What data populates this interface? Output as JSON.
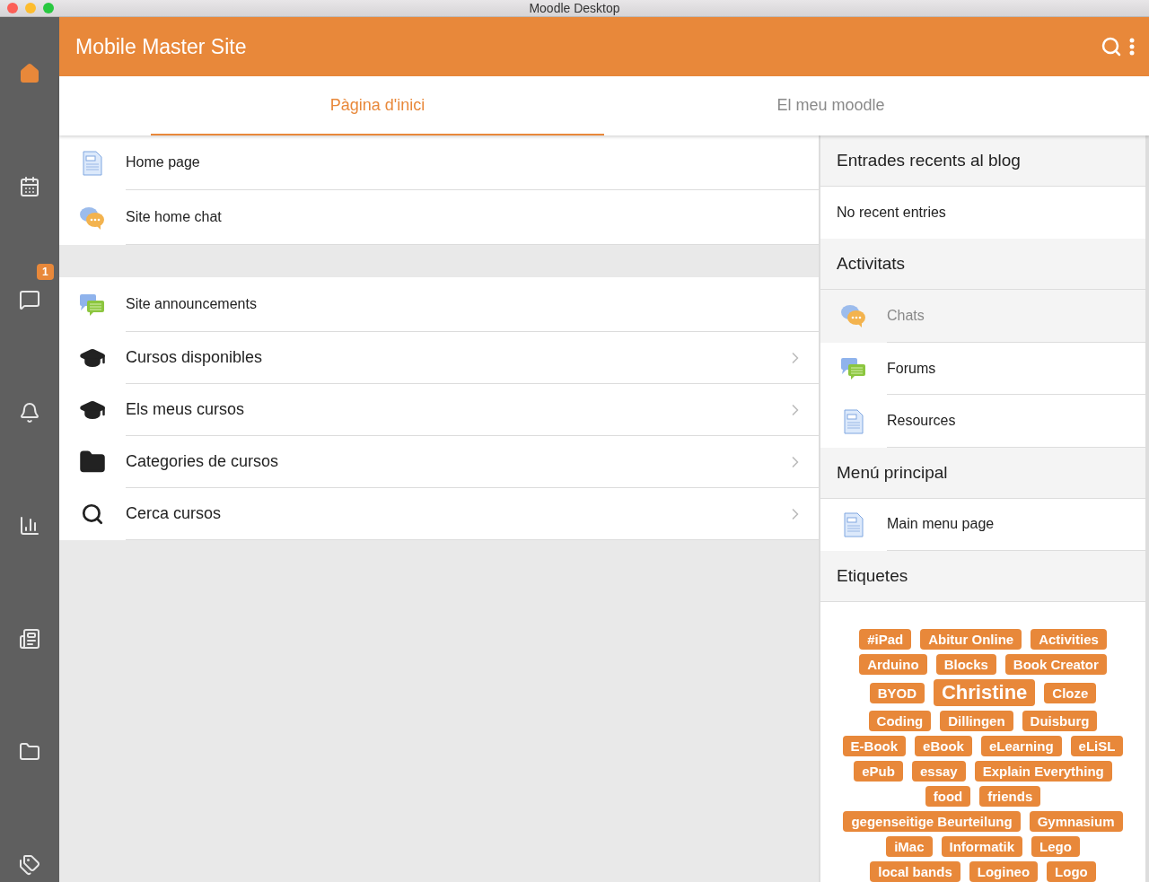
{
  "window": {
    "title": "Moodle Desktop"
  },
  "sidebar": {
    "items": [
      {
        "selected": true
      },
      {
        "selected": false
      },
      {
        "selected": false,
        "badge": "1"
      },
      {
        "selected": false
      },
      {
        "selected": false
      },
      {
        "selected": false
      },
      {
        "selected": false
      },
      {
        "selected": false
      }
    ]
  },
  "header": {
    "title": "Mobile Master Site"
  },
  "tabs": [
    {
      "label": "Pàgina d'inici",
      "selected": true
    },
    {
      "label": "El meu moodle",
      "selected": false
    }
  ],
  "main_sections": [
    {
      "items": [
        {
          "kind": "page",
          "label": "Home page"
        },
        {
          "kind": "chat",
          "label": "Site home chat"
        }
      ]
    },
    {
      "items": [
        {
          "kind": "forum",
          "label": "Site announcements"
        },
        {
          "kind": "cap",
          "label": "Cursos disponibles"
        },
        {
          "kind": "cap",
          "label": "Els meus cursos"
        },
        {
          "kind": "folder",
          "label": "Categories de cursos"
        },
        {
          "kind": "search",
          "label": "Cerca cursos"
        }
      ]
    }
  ],
  "blocks": [
    {
      "title": "Entrades recents al blog",
      "items": [
        {
          "kind": "text",
          "label": "No recent entries",
          "disabled": false
        }
      ]
    },
    {
      "title": "Activitats",
      "items": [
        {
          "kind": "chat",
          "label": "Chats",
          "disabled": true
        },
        {
          "kind": "forum",
          "label": "Forums",
          "disabled": false
        },
        {
          "kind": "page",
          "label": "Resources",
          "disabled": false
        }
      ]
    },
    {
      "title": "Menú principal",
      "items": [
        {
          "kind": "page",
          "label": "Main menu page",
          "disabled": false
        }
      ]
    },
    {
      "title": "Etiquetes",
      "tags": [
        {
          "label": "#iPad",
          "kind": "normal"
        },
        {
          "label": "Abitur Online",
          "kind": "normal"
        },
        {
          "label": "Activities",
          "kind": "normal"
        },
        {
          "label": "Arduino",
          "kind": "normal"
        },
        {
          "label": "Blocks",
          "kind": "normal"
        },
        {
          "label": "Book Creator",
          "kind": "normal"
        },
        {
          "label": "BYOD",
          "kind": "normal"
        },
        {
          "label": "Christine",
          "kind": "large"
        },
        {
          "label": "Cloze",
          "kind": "normal"
        },
        {
          "label": "Coding",
          "kind": "normal"
        },
        {
          "label": "Dillingen",
          "kind": "normal"
        },
        {
          "label": "Duisburg",
          "kind": "normal"
        },
        {
          "label": "E-Book",
          "kind": "normal"
        },
        {
          "label": "eBook",
          "kind": "normal"
        },
        {
          "label": "eLearning",
          "kind": "normal"
        },
        {
          "label": "eLiSL",
          "kind": "normal"
        },
        {
          "label": "ePub",
          "kind": "normal"
        },
        {
          "label": "essay",
          "kind": "normal"
        },
        {
          "label": "Explain Everything",
          "kind": "normal"
        },
        {
          "label": "food",
          "kind": "normal"
        },
        {
          "label": "friends",
          "kind": "normal"
        },
        {
          "label": "gegenseitige Beurteilung",
          "kind": "normal"
        },
        {
          "label": "Gymnasium",
          "kind": "normal"
        },
        {
          "label": "iMac",
          "kind": "normal"
        },
        {
          "label": "Informatik",
          "kind": "normal"
        },
        {
          "label": "Lego",
          "kind": "normal"
        },
        {
          "label": "local bands",
          "kind": "normal"
        },
        {
          "label": "Logineo",
          "kind": "normal"
        },
        {
          "label": "Logo",
          "kind": "normal"
        }
      ]
    }
  ]
}
